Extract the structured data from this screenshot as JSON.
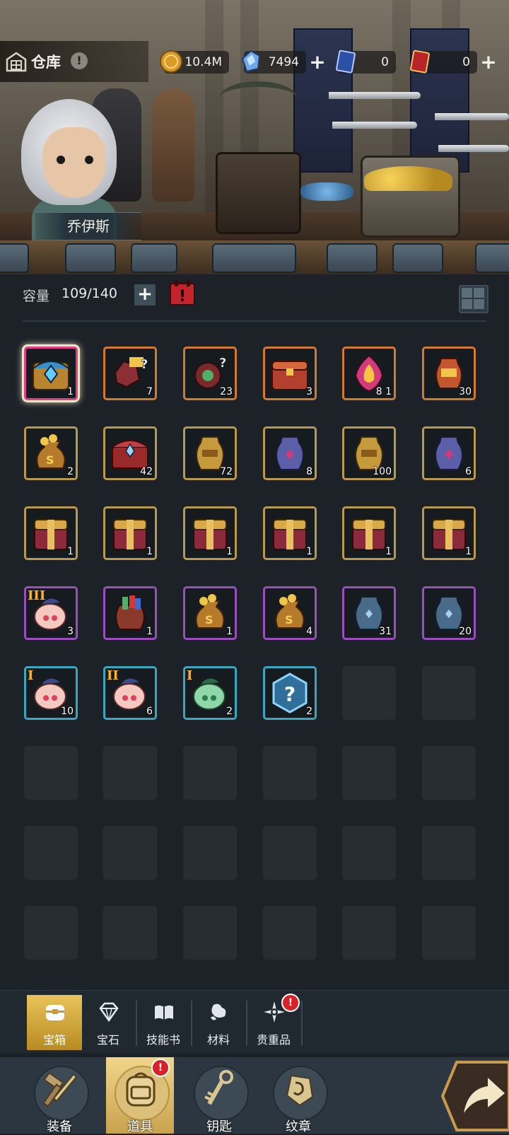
{
  "header": {
    "title": "仓库",
    "currencies": [
      {
        "name": "gold",
        "value": "10.4M",
        "has_plus": false
      },
      {
        "name": "crystal",
        "value": "7494",
        "has_plus": true
      },
      {
        "name": "card-blue",
        "value": "0",
        "has_plus": false
      },
      {
        "name": "card-red",
        "value": "0",
        "has_plus": true
      }
    ]
  },
  "hero": {
    "name": "乔伊斯"
  },
  "capacity": {
    "label": "容量",
    "value": "109/140"
  },
  "inventory": {
    "items": [
      {
        "art": "gem-chest",
        "count": "1",
        "rarity": "pink",
        "selected": true
      },
      {
        "art": "ore-mystery",
        "count": "7",
        "rarity": "orange"
      },
      {
        "art": "flower-mystery",
        "count": "23",
        "rarity": "orange"
      },
      {
        "art": "red-chest",
        "count": "3",
        "rarity": "orange"
      },
      {
        "art": "flame-crest",
        "count": "8 1",
        "rarity": "orange"
      },
      {
        "art": "red-urn",
        "count": "30",
        "rarity": "orange"
      },
      {
        "art": "coin-bag",
        "count": "2",
        "rarity": "gold"
      },
      {
        "art": "crown-chest",
        "count": "42",
        "rarity": "gold"
      },
      {
        "art": "gold-urn",
        "count": "72",
        "rarity": "gold"
      },
      {
        "art": "purple-urn",
        "count": "8",
        "rarity": "gold"
      },
      {
        "art": "gold-urn",
        "count": "100",
        "rarity": "gold"
      },
      {
        "art": "purple-urn",
        "count": "6",
        "rarity": "gold"
      },
      {
        "art": "gift-chest",
        "count": "1",
        "rarity": "gold"
      },
      {
        "art": "gift-chest",
        "count": "1",
        "rarity": "gold"
      },
      {
        "art": "gift-chest",
        "count": "1",
        "rarity": "gold"
      },
      {
        "art": "gift-chest",
        "count": "1",
        "rarity": "gold"
      },
      {
        "art": "gift-chest",
        "count": "1",
        "rarity": "gold"
      },
      {
        "art": "gift-chest",
        "count": "1",
        "rarity": "gold"
      },
      {
        "art": "pink-pouch",
        "count": "3",
        "rarity": "purple",
        "tier": "III"
      },
      {
        "art": "scroll-sack",
        "count": "1",
        "rarity": "purple"
      },
      {
        "art": "coin-bag",
        "count": "1",
        "rarity": "purple"
      },
      {
        "art": "coin-bag",
        "count": "4",
        "rarity": "purple"
      },
      {
        "art": "steel-urn",
        "count": "31",
        "rarity": "purple"
      },
      {
        "art": "steel-urn",
        "count": "20",
        "rarity": "purple"
      },
      {
        "art": "pink-pouch",
        "count": "10",
        "rarity": "blue",
        "tier": "I"
      },
      {
        "art": "pink-pouch",
        "count": "6",
        "rarity": "blue",
        "tier": "II"
      },
      {
        "art": "green-pouch",
        "count": "2",
        "rarity": "blue",
        "tier": "I"
      },
      {
        "art": "question-hex",
        "count": "2",
        "rarity": "blue"
      }
    ],
    "total_slots": 48
  },
  "category_tabs": [
    {
      "label": "宝箱",
      "icon": "chest-icon",
      "active": true,
      "badge": false
    },
    {
      "label": "宝石",
      "icon": "diamond-icon",
      "active": false,
      "badge": false
    },
    {
      "label": "技能书",
      "icon": "book-icon",
      "active": false,
      "badge": false
    },
    {
      "label": "材料",
      "icon": "material-icon",
      "active": false,
      "badge": false
    },
    {
      "label": "贵重品",
      "icon": "star-compass-icon",
      "active": false,
      "badge": true
    }
  ],
  "bottom_nav": [
    {
      "label": "装备",
      "icon": "hammer-sword-icon",
      "active": false,
      "badge": false
    },
    {
      "label": "道具",
      "icon": "backpack-icon",
      "active": true,
      "badge": true
    },
    {
      "label": "钥匙",
      "icon": "key-icon",
      "active": false,
      "badge": false
    },
    {
      "label": "纹章",
      "icon": "emblem-icon",
      "active": false,
      "badge": false
    }
  ],
  "colors": {
    "rarity_pink": "#e0408a",
    "rarity_orange": "#d27a2e",
    "rarity_gold": "#b89a4a",
    "rarity_purple": "#9b4fbf",
    "rarity_blue": "#3aa7c0",
    "active_tab": "#e9c35a",
    "badge_red": "#d8222a"
  }
}
